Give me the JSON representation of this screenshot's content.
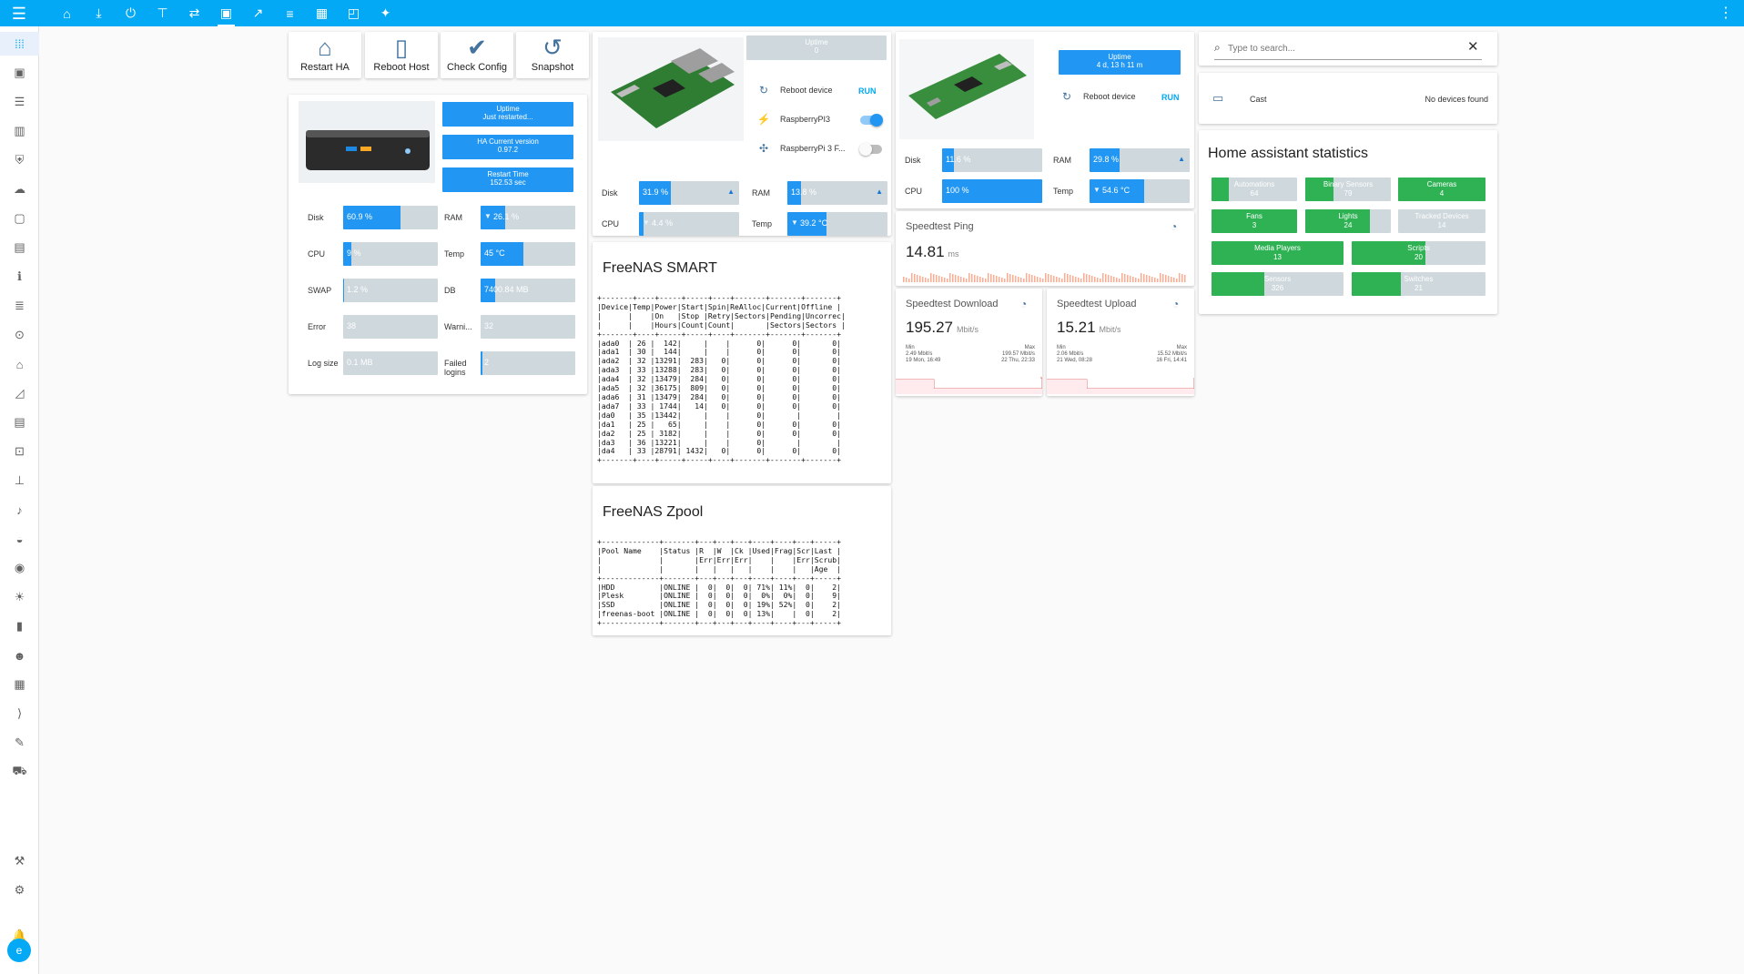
{
  "colors": {
    "primary": "#03a9f4",
    "bar_fill": "#2196f3",
    "bar_bg": "#cfd8dc",
    "stat_green": "#2fb254",
    "icon": "#44739e"
  },
  "topbar": {
    "menu_icon": "menu-icon",
    "tabs": [
      "home-icon",
      "download-icon",
      "power-icon",
      "antenna-icon",
      "switch-icon",
      "server-icon",
      "chart-icon",
      "list-icon",
      "film-icon",
      "cast-icon",
      "sparkle-icon"
    ],
    "right_icon": "more-vert-icon"
  },
  "sidebar": {
    "items": [
      "grid-icon",
      "person-icon",
      "list-icon",
      "chart-icon",
      "shield-icon",
      "cloud-icon",
      "box-icon",
      "card-icon",
      "info-icon",
      "log-icon",
      "play-icon",
      "home-icon",
      "stats-icon",
      "doc-icon",
      "nodes-icon",
      "tree-icon",
      "mic-icon",
      "duck-icon",
      "radio-icon",
      "bulb-icon",
      "book-icon",
      "people-icon",
      "table-icon",
      "code-icon",
      "brush-icon",
      "cart-icon"
    ],
    "bottom_items": [
      "hammer-icon",
      "gear-icon",
      "bell-icon"
    ],
    "user_initial": "e"
  },
  "col1": {
    "buttons": [
      {
        "label": "Restart HA",
        "icon": "home-assistant-icon"
      },
      {
        "label": "Reboot Host",
        "icon": "server-icon"
      },
      {
        "label": "Check Config",
        "icon": "clipboard-check-icon"
      },
      {
        "label": "Snapshot",
        "icon": "backup-restore-icon"
      }
    ],
    "chips": [
      {
        "title": "Uptime",
        "value": "Just restarted..."
      },
      {
        "title": "HA Current version",
        "value": "0.97.2"
      },
      {
        "title": "Restart Time",
        "value": "152.53 sec"
      }
    ],
    "stats": [
      {
        "label": "Disk",
        "value": "60.9 %",
        "fill": 0.609
      },
      {
        "label": "RAM",
        "value": "26.1 %",
        "fill": 0.261,
        "arrow": "▼"
      },
      {
        "label": "CPU",
        "value": "9 %",
        "fill": 0.09
      },
      {
        "label": "Temp",
        "value": "45 °C",
        "fill": 0.45
      },
      {
        "label": "SWAP",
        "value": "1.2 %",
        "fill": 0.012
      },
      {
        "label": "DB",
        "value": "7400.84 MB",
        "fill": 0.15
      },
      {
        "label": "Error",
        "value": "38",
        "fill": 0.0
      },
      {
        "label": "Warni...",
        "value": "32",
        "fill": 0.0
      },
      {
        "label": "Log size",
        "value": "0.1 MB",
        "fill": 0.0
      },
      {
        "label": "Failed logins",
        "value": "2",
        "fill": 0.02
      }
    ]
  },
  "col2": {
    "uptime_title": "Uptime",
    "uptime_value": "0",
    "rows": [
      {
        "label": "Reboot device",
        "icon": "restart-icon",
        "action": "RUN"
      },
      {
        "label": "RaspberryPI3",
        "icon": "flash-icon",
        "toggle": true
      },
      {
        "label": "RaspberryPi 3 F...",
        "icon": "fan-icon",
        "toggle": false
      }
    ],
    "stats": [
      {
        "label": "Disk",
        "value": "31.9 %",
        "fill": 0.319,
        "arrow": "▲"
      },
      {
        "label": "RAM",
        "value": "13.8 %",
        "fill": 0.138,
        "arrow": "▲"
      },
      {
        "label": "CPU",
        "value": "4.4 %",
        "fill": 0.044,
        "arrow": "▼"
      },
      {
        "label": "Temp",
        "value": "39.2 °C",
        "fill": 0.392,
        "arrow": "▼"
      }
    ],
    "smart_title": "FreeNAS SMART",
    "smart_text": "+-------+----+-----+-----+----+-------+-------+-------+\n|Device|Temp|Power|Start|Spin|ReAlloc|Current|Offline |\n|      |    |On   |Stop |Retry|Sectors|Pending|Uncorrec|\n|      |    |Hours|Count|Count|       |Sectors|Sectors |\n+-------+----+-----+-----+----+-------+-------+-------+\n|ada0  | 26 |  142|     |    |      0|      0|       0|\n|ada1  | 30 |  144|     |    |      0|      0|       0|\n|ada2  | 32 |13291|  283|   0|      0|      0|       0|\n|ada3  | 33 |13288|  283|   0|      0|      0|       0|\n|ada4  | 32 |13479|  284|   0|      0|      0|       0|\n|ada5  | 32 |36175|  809|   0|      0|      0|       0|\n|ada6  | 31 |13479|  284|   0|      0|      0|       0|\n|ada7  | 33 | 1744|   14|   0|      0|      0|       0|\n|da0   | 35 |13442|     |    |      0|       |        |\n|da1   | 25 |   65|     |    |      0|      0|       0|\n|da2   | 25 | 3182|     |    |      0|      0|       0|\n|da3   | 36 |13221|     |    |      0|       |        |\n|da4   | 33 |28791| 1432|   0|      0|      0|       0|\n+-------+----+-----+-----+----+-------+-------+-------+",
    "zpool_title": "FreeNAS Zpool",
    "zpool_text": "+-------------+-------+---+---+---+----+----+---+-----+\n|Pool Name    |Status |R  |W  |Ck |Used|Frag|Scr|Last |\n|             |       |Err|Err|Err|    |    |Err|Scrub|\n|             |       |   |   |   |    |    |   |Age  |\n+-------------+-------+---+---+---+----+----+---+-----+\n|HDD          |ONLINE |  0|  0|  0| 71%| 11%|  0|    2|\n|Plesk        |ONLINE |  0|  0|  0|  0%|  0%|  0|    9|\n|SSD          |ONLINE |  0|  0|  0| 19%| 52%|  0|    2|\n|freenas-boot |ONLINE |  0|  0|  0| 13%|    |  0|    2|\n+-------------+-------+---+---+---+----+----+---+-----+"
  },
  "col3": {
    "uptime_title": "Uptime",
    "uptime_value": "4 d, 13 h 11 m",
    "reboot": {
      "label": "Reboot device",
      "icon": "restart-icon",
      "action": "RUN"
    },
    "stats": [
      {
        "label": "Disk",
        "value": "11.6 %",
        "fill": 0.116
      },
      {
        "label": "RAM",
        "value": "29.8 %",
        "fill": 0.298,
        "arrow": "▲"
      },
      {
        "label": "CPU",
        "value": "100 %",
        "fill": 1.0
      },
      {
        "label": "Temp",
        "value": "54.6 °C",
        "fill": 0.546,
        "arrow": "▼"
      }
    ],
    "ping": {
      "name": "Speedtest Ping",
      "value": "14.81",
      "unit": "ms"
    },
    "download": {
      "name": "Speedtest Download",
      "value": "195.27",
      "unit": "Mbit/s",
      "min_label": "Min",
      "min_value": "2.49 Mbit/s",
      "min_time": "19 Mon, 16:49",
      "max_label": "Max",
      "max_value": "199.57 Mbit/s",
      "max_time": "22 Thu, 22:33"
    },
    "upload": {
      "name": "Speedtest Upload",
      "value": "15.21",
      "unit": "Mbit/s",
      "min_label": "Min",
      "min_value": "2.06 Mbit/s",
      "min_time": "21 Wed, 08:28",
      "max_label": "Max",
      "max_value": "15.52 Mbit/s",
      "max_time": "16 Fri, 14:41"
    }
  },
  "col4": {
    "search_placeholder": "Type to search...",
    "cast_label": "Cast",
    "cast_status": "No devices found",
    "stats_title": "Home assistant statistics",
    "tiles": [
      {
        "name": "Automations",
        "count": "64",
        "fill": 0.2
      },
      {
        "name": "Binary Sensors",
        "count": "79",
        "fill": 0.33
      },
      {
        "name": "Cameras",
        "count": "4",
        "fill": 1.0
      },
      {
        "name": "Fans",
        "count": "3",
        "fill": 1.0
      },
      {
        "name": "Lights",
        "count": "24",
        "fill": 0.75
      },
      {
        "name": "Tracked Devices",
        "count": "14",
        "fill": 0.0
      },
      {
        "name": "Media Players",
        "count": "13",
        "fill": 1.0
      },
      {
        "name": "Scripts",
        "count": "20",
        "fill": 0.55
      },
      {
        "name": "Sensors",
        "count": "326",
        "fill": 0.4
      },
      {
        "name": "Switches",
        "count": "21",
        "fill": 0.37
      }
    ]
  }
}
